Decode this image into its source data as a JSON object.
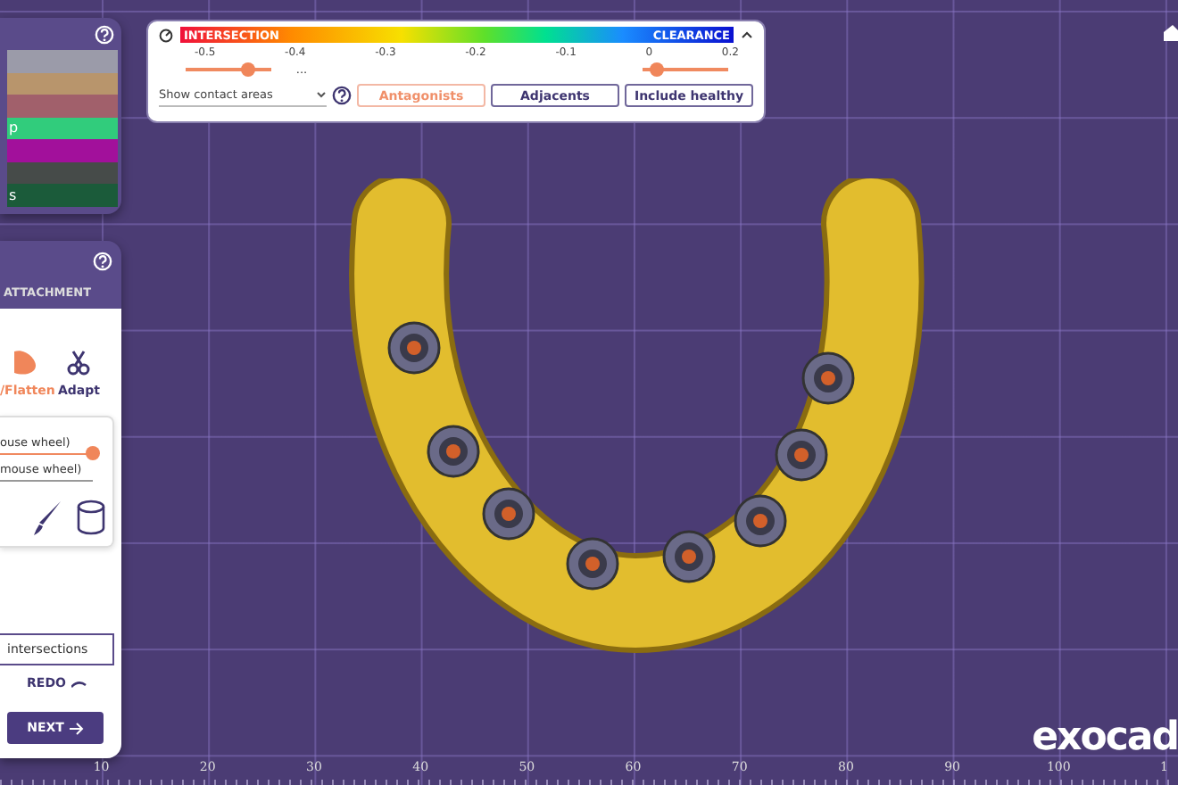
{
  "color_list": [
    {
      "color": "#9b9ba9"
    },
    {
      "color": "#b8956c"
    },
    {
      "color": "#a1606b"
    },
    {
      "color": "#31cc7c",
      "label": "p"
    },
    {
      "color": "#a2109b"
    },
    {
      "color": "#464b49"
    },
    {
      "color": "#1b5b3a",
      "label": "s"
    }
  ],
  "distance_scale": {
    "left_label": "INTERSECTION",
    "right_label": "CLEARANCE",
    "ticks": [
      "-0.5",
      "-0.4",
      "-0.3",
      "-0.2",
      "-0.1",
      "0",
      "0.2"
    ],
    "min_slider": {
      "level": 0.73
    },
    "ellipsis": "...",
    "max_slider": {
      "level": 0.17
    },
    "dropdown": {
      "value": "Show contact areas"
    },
    "buttons": [
      {
        "label": "Antagonists",
        "selected": true
      },
      {
        "label": "Adjacents",
        "selected": false
      },
      {
        "label": "Include healthy",
        "selected": false
      }
    ]
  },
  "tool_panel": {
    "title": "ATTACHMENT",
    "tools": [
      {
        "label": "/Flatten",
        "selected": true
      },
      {
        "label": "Adapt",
        "selected": false
      }
    ],
    "sliders": [
      {
        "label": "ouse wheel)",
        "level": 1
      },
      {
        "label": "mouse wheel)"
      }
    ],
    "intersections_button": "intersections",
    "redo": "REDO",
    "next": "NEXT"
  },
  "ruler": [
    "10",
    "20",
    "30",
    "40",
    "50",
    "60",
    "70",
    "80",
    "90",
    "100",
    "1"
  ],
  "logo": "exocad"
}
